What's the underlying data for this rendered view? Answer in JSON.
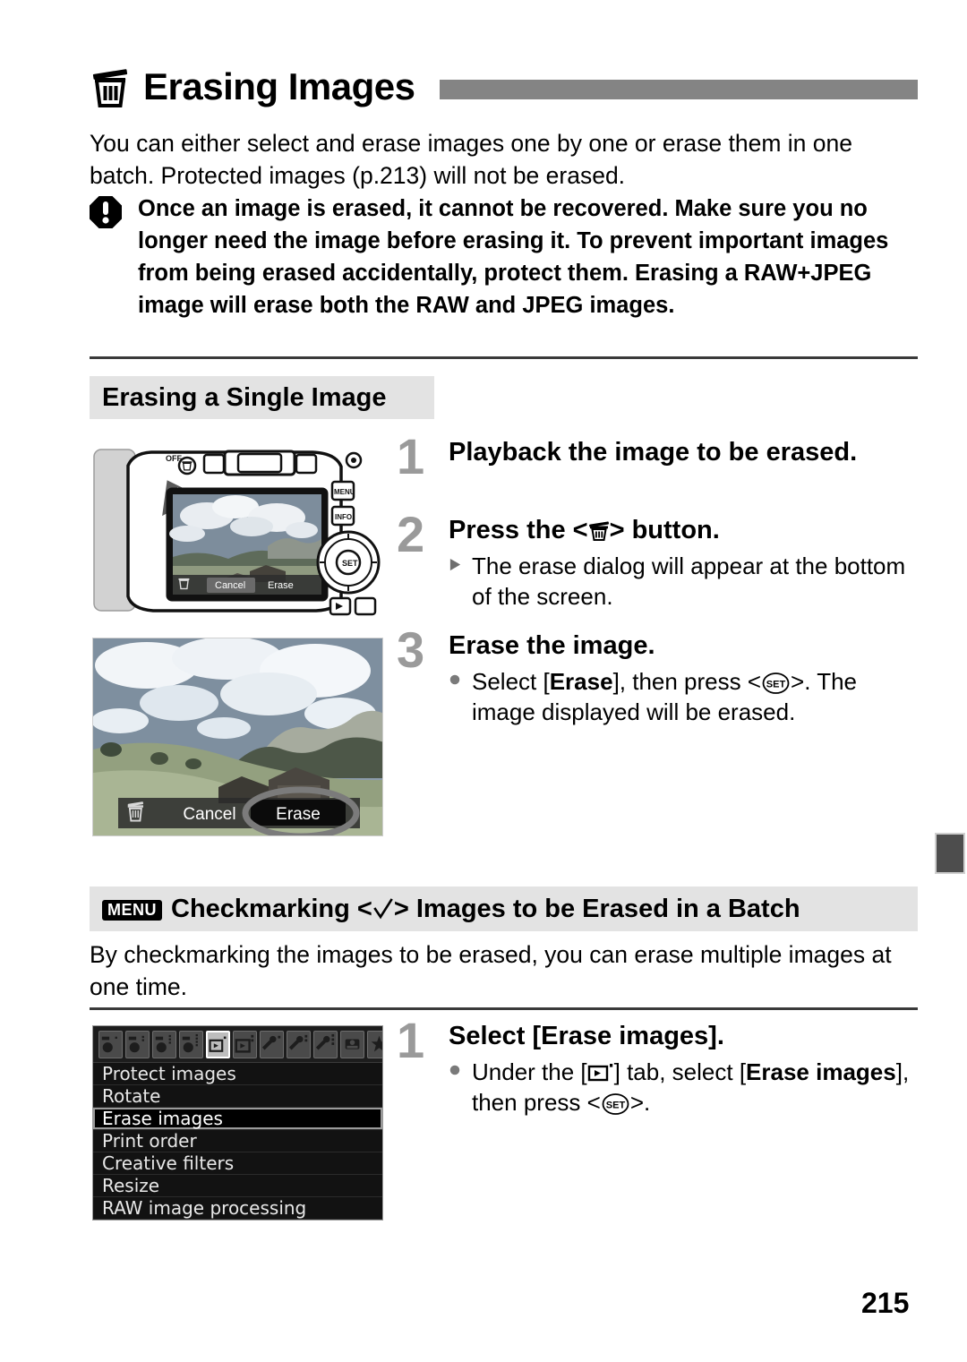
{
  "page": {
    "number": "215",
    "title": "Erasing Images",
    "title_icon": "trash-icon"
  },
  "intro": "You can either select and erase images one by one or erase them in one batch. Protected images (p.213) will not be erased.",
  "warning": {
    "icon": "warning-exclamation-icon",
    "text": "Once an image is erased, it cannot be recovered. Make sure you no longer need the image before erasing it. To prevent important images from being erased accidentally, protect them. Erasing a RAW+JPEG image will erase both the RAW and JPEG images."
  },
  "section_single": {
    "heading": "Erasing a Single Image",
    "steps": [
      {
        "number": "1",
        "title": "Playback the image to be erased.",
        "sub": []
      },
      {
        "number": "2",
        "title_before": "Press the <",
        "title_icon": "trash-icon",
        "title_after": "> button.",
        "sub_marker": "triangle",
        "sub": "The erase dialog will appear at the bottom of the screen."
      },
      {
        "number": "3",
        "title": "Erase the image.",
        "sub_marker": "dot",
        "sub_part1": "Select [",
        "sub_bold1": "Erase",
        "sub_part2": "], then press <",
        "sub_icon": "set-button-icon",
        "sub_part3": ">. The image displayed will be erased."
      }
    ],
    "camera_figure": {
      "name": "camera-back-illustration",
      "power_label": "OFF",
      "button_labels": [
        "MENU",
        "INFO.",
        "SET"
      ],
      "lcd_dialog": {
        "icon": "trash-icon",
        "cancel_label": "Cancel",
        "erase_label": "Erase"
      }
    },
    "lcd_figure": {
      "name": "erase-dialog-screenshot",
      "icon": "trash-icon",
      "cancel_label": "Cancel",
      "erase_label": "Erase",
      "highlighted": "Erase"
    }
  },
  "section_batch": {
    "menu_tag": "MENU",
    "heading_before": "Checkmarking <",
    "heading_icon": "checkmark-icon",
    "heading_after": "> Images to be Erased in a Batch",
    "intro": "By checkmarking the images to be erased, you can erase multiple images at one time.",
    "steps": [
      {
        "number": "1",
        "title": "Select [Erase images].",
        "sub_marker": "dot",
        "sub_part1": "Under the [",
        "sub_icon1": "playback-tab-icon",
        "sub_part2": "] tab, select [",
        "sub_bold1": "Erase images",
        "sub_part3": "], then press <",
        "sub_icon2": "set-button-icon",
        "sub_part4": ">."
      }
    ],
    "menu_screenshot": {
      "name": "camera-menu-screenshot",
      "tabs": [
        "camera-tab-1",
        "camera-tab-2",
        "camera-tab-3",
        "camera-tab-4",
        "playback-tab-1",
        "playback-tab-2",
        "setup-tab-1",
        "setup-tab-2",
        "setup-tab-3",
        "custom-func-tab",
        "my-menu-tab"
      ],
      "selected_tab_index": 4,
      "items": [
        "Protect images",
        "Rotate",
        "Erase images",
        "Print order",
        "Creative filters",
        "Resize",
        "RAW image processing"
      ],
      "highlighted_item": "Erase images"
    }
  },
  "colors": {
    "title_bar": "#848484",
    "subhead_bg": "#e3e3e3",
    "step_number": "#9a9a9a",
    "rule": "#3a3a3a",
    "edge_tab": "#4d4d4d"
  }
}
